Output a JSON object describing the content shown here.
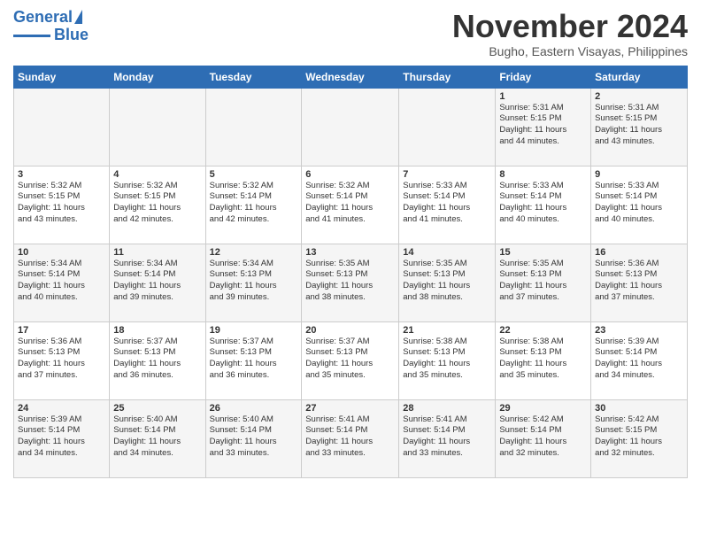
{
  "header": {
    "logo": {
      "line1": "General",
      "line2": "Blue"
    },
    "title": "November 2024",
    "location": "Bugho, Eastern Visayas, Philippines"
  },
  "calendar": {
    "weekdays": [
      "Sunday",
      "Monday",
      "Tuesday",
      "Wednesday",
      "Thursday",
      "Friday",
      "Saturday"
    ],
    "weeks": [
      [
        {
          "day": "",
          "info": ""
        },
        {
          "day": "",
          "info": ""
        },
        {
          "day": "",
          "info": ""
        },
        {
          "day": "",
          "info": ""
        },
        {
          "day": "",
          "info": ""
        },
        {
          "day": "1",
          "info": "Sunrise: 5:31 AM\nSunset: 5:15 PM\nDaylight: 11 hours\nand 44 minutes."
        },
        {
          "day": "2",
          "info": "Sunrise: 5:31 AM\nSunset: 5:15 PM\nDaylight: 11 hours\nand 43 minutes."
        }
      ],
      [
        {
          "day": "3",
          "info": "Sunrise: 5:32 AM\nSunset: 5:15 PM\nDaylight: 11 hours\nand 43 minutes."
        },
        {
          "day": "4",
          "info": "Sunrise: 5:32 AM\nSunset: 5:15 PM\nDaylight: 11 hours\nand 42 minutes."
        },
        {
          "day": "5",
          "info": "Sunrise: 5:32 AM\nSunset: 5:14 PM\nDaylight: 11 hours\nand 42 minutes."
        },
        {
          "day": "6",
          "info": "Sunrise: 5:32 AM\nSunset: 5:14 PM\nDaylight: 11 hours\nand 41 minutes."
        },
        {
          "day": "7",
          "info": "Sunrise: 5:33 AM\nSunset: 5:14 PM\nDaylight: 11 hours\nand 41 minutes."
        },
        {
          "day": "8",
          "info": "Sunrise: 5:33 AM\nSunset: 5:14 PM\nDaylight: 11 hours\nand 40 minutes."
        },
        {
          "day": "9",
          "info": "Sunrise: 5:33 AM\nSunset: 5:14 PM\nDaylight: 11 hours\nand 40 minutes."
        }
      ],
      [
        {
          "day": "10",
          "info": "Sunrise: 5:34 AM\nSunset: 5:14 PM\nDaylight: 11 hours\nand 40 minutes."
        },
        {
          "day": "11",
          "info": "Sunrise: 5:34 AM\nSunset: 5:14 PM\nDaylight: 11 hours\nand 39 minutes."
        },
        {
          "day": "12",
          "info": "Sunrise: 5:34 AM\nSunset: 5:13 PM\nDaylight: 11 hours\nand 39 minutes."
        },
        {
          "day": "13",
          "info": "Sunrise: 5:35 AM\nSunset: 5:13 PM\nDaylight: 11 hours\nand 38 minutes."
        },
        {
          "day": "14",
          "info": "Sunrise: 5:35 AM\nSunset: 5:13 PM\nDaylight: 11 hours\nand 38 minutes."
        },
        {
          "day": "15",
          "info": "Sunrise: 5:35 AM\nSunset: 5:13 PM\nDaylight: 11 hours\nand 37 minutes."
        },
        {
          "day": "16",
          "info": "Sunrise: 5:36 AM\nSunset: 5:13 PM\nDaylight: 11 hours\nand 37 minutes."
        }
      ],
      [
        {
          "day": "17",
          "info": "Sunrise: 5:36 AM\nSunset: 5:13 PM\nDaylight: 11 hours\nand 37 minutes."
        },
        {
          "day": "18",
          "info": "Sunrise: 5:37 AM\nSunset: 5:13 PM\nDaylight: 11 hours\nand 36 minutes."
        },
        {
          "day": "19",
          "info": "Sunrise: 5:37 AM\nSunset: 5:13 PM\nDaylight: 11 hours\nand 36 minutes."
        },
        {
          "day": "20",
          "info": "Sunrise: 5:37 AM\nSunset: 5:13 PM\nDaylight: 11 hours\nand 35 minutes."
        },
        {
          "day": "21",
          "info": "Sunrise: 5:38 AM\nSunset: 5:13 PM\nDaylight: 11 hours\nand 35 minutes."
        },
        {
          "day": "22",
          "info": "Sunrise: 5:38 AM\nSunset: 5:13 PM\nDaylight: 11 hours\nand 35 minutes."
        },
        {
          "day": "23",
          "info": "Sunrise: 5:39 AM\nSunset: 5:14 PM\nDaylight: 11 hours\nand 34 minutes."
        }
      ],
      [
        {
          "day": "24",
          "info": "Sunrise: 5:39 AM\nSunset: 5:14 PM\nDaylight: 11 hours\nand 34 minutes."
        },
        {
          "day": "25",
          "info": "Sunrise: 5:40 AM\nSunset: 5:14 PM\nDaylight: 11 hours\nand 34 minutes."
        },
        {
          "day": "26",
          "info": "Sunrise: 5:40 AM\nSunset: 5:14 PM\nDaylight: 11 hours\nand 33 minutes."
        },
        {
          "day": "27",
          "info": "Sunrise: 5:41 AM\nSunset: 5:14 PM\nDaylight: 11 hours\nand 33 minutes."
        },
        {
          "day": "28",
          "info": "Sunrise: 5:41 AM\nSunset: 5:14 PM\nDaylight: 11 hours\nand 33 minutes."
        },
        {
          "day": "29",
          "info": "Sunrise: 5:42 AM\nSunset: 5:14 PM\nDaylight: 11 hours\nand 32 minutes."
        },
        {
          "day": "30",
          "info": "Sunrise: 5:42 AM\nSunset: 5:15 PM\nDaylight: 11 hours\nand 32 minutes."
        }
      ]
    ]
  }
}
